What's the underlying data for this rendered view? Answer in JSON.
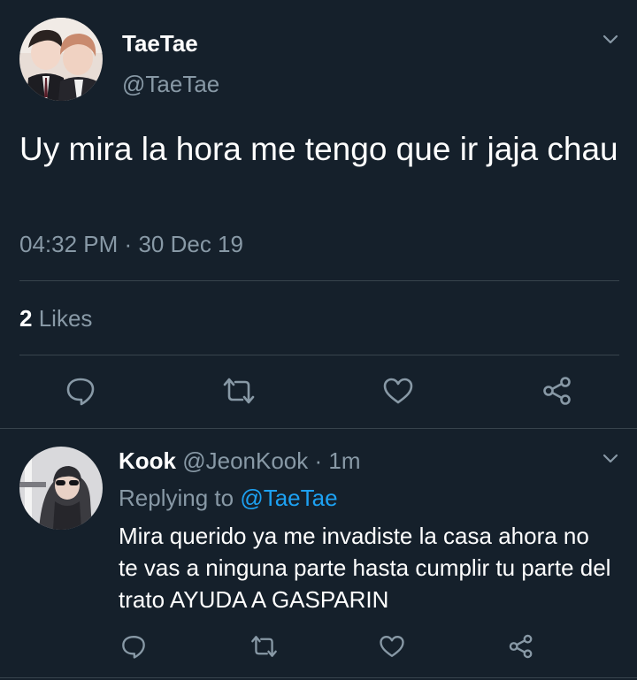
{
  "main_tweet": {
    "display_name": "TaeTae",
    "handle": "@TaeTae",
    "text": "Uy mira la hora me tengo que ir jaja chau",
    "time": "04:32 PM",
    "separator": "·",
    "date": "30 Dec 19",
    "likes_count": "2",
    "likes_label": "Likes",
    "actions": [
      "reply-icon",
      "retweet-icon",
      "like-icon",
      "share-icon"
    ]
  },
  "reply": {
    "display_name": "Kook",
    "handle": "@JeonKook",
    "separator": "·",
    "age": "1m",
    "replying_prefix": "Replying to",
    "replying_handle": "@TaeTae",
    "text": "Mira querido ya me invadiste la casa ahora no te vas a ninguna parte hasta cumplir tu parte del trato AYUDA A GASPARIN",
    "actions": [
      "reply-icon",
      "retweet-icon",
      "like-icon",
      "share-icon"
    ]
  },
  "colors": {
    "background": "#15202b",
    "text": "#ffffff",
    "muted": "#8899a6",
    "link": "#1da1f2",
    "divider": "#38444d"
  }
}
